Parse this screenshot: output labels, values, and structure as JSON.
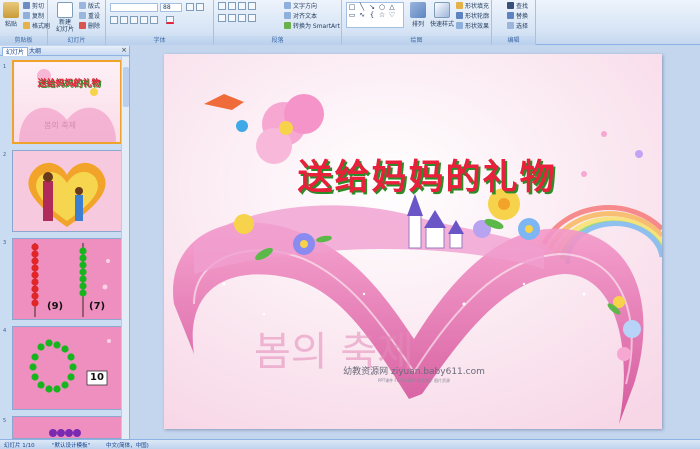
{
  "ribbon": {
    "clipboard": {
      "paste": "粘贴",
      "cut": "剪切",
      "copy": "复制",
      "format_painter": "格式刷",
      "label": "剪贴板"
    },
    "slides": {
      "new_slide": "新建\n幻灯片",
      "layout": "版式",
      "reset": "重设",
      "delete": "删除",
      "label": "幻灯片"
    },
    "font": {
      "size": "88",
      "label": "字体"
    },
    "paragraph": {
      "text_direction": "文字方向",
      "align_text": "对齐文本",
      "convert_smartart": "转换为 SmartArt",
      "label": "段落"
    },
    "drawing": {
      "arrange": "排列",
      "quick_styles": "快速样式",
      "shape_fill": "形状填充",
      "shape_outline": "形状轮廓",
      "shape_effects": "形状效果",
      "label": "绘图"
    },
    "editing": {
      "find": "查找",
      "replace": "替换",
      "select": "选择",
      "label": "编辑"
    }
  },
  "panel": {
    "tab_slides": "幻灯片",
    "tab_outline": "大纲",
    "close": "×",
    "slides": [
      {
        "num": "1",
        "title": "送给妈妈的礼物",
        "watermark": "봄의 축제"
      },
      {
        "num": "2"
      },
      {
        "num": "3",
        "left_label": "(9)",
        "right_label": "(7)"
      },
      {
        "num": "4",
        "badge": "10"
      },
      {
        "num": "5"
      }
    ]
  },
  "slide": {
    "title": "送给妈妈的礼物",
    "watermark": "幼教资源网 ziyuan.baby611.com",
    "watermark_sub": "PPT课件 FLASH课件 教案教学 图片资源",
    "korean": "봄의 축제"
  },
  "status": {
    "slide_pos": "幻灯片 1/10",
    "theme": "\"默认设计模板\"",
    "lang": "中文(简体，中国)"
  },
  "colors": {
    "title_red": "#e8203c",
    "title_shadow": "#2a8d28",
    "ribbon_bg": "#d6e4f5",
    "selection": "#f0a32c"
  }
}
